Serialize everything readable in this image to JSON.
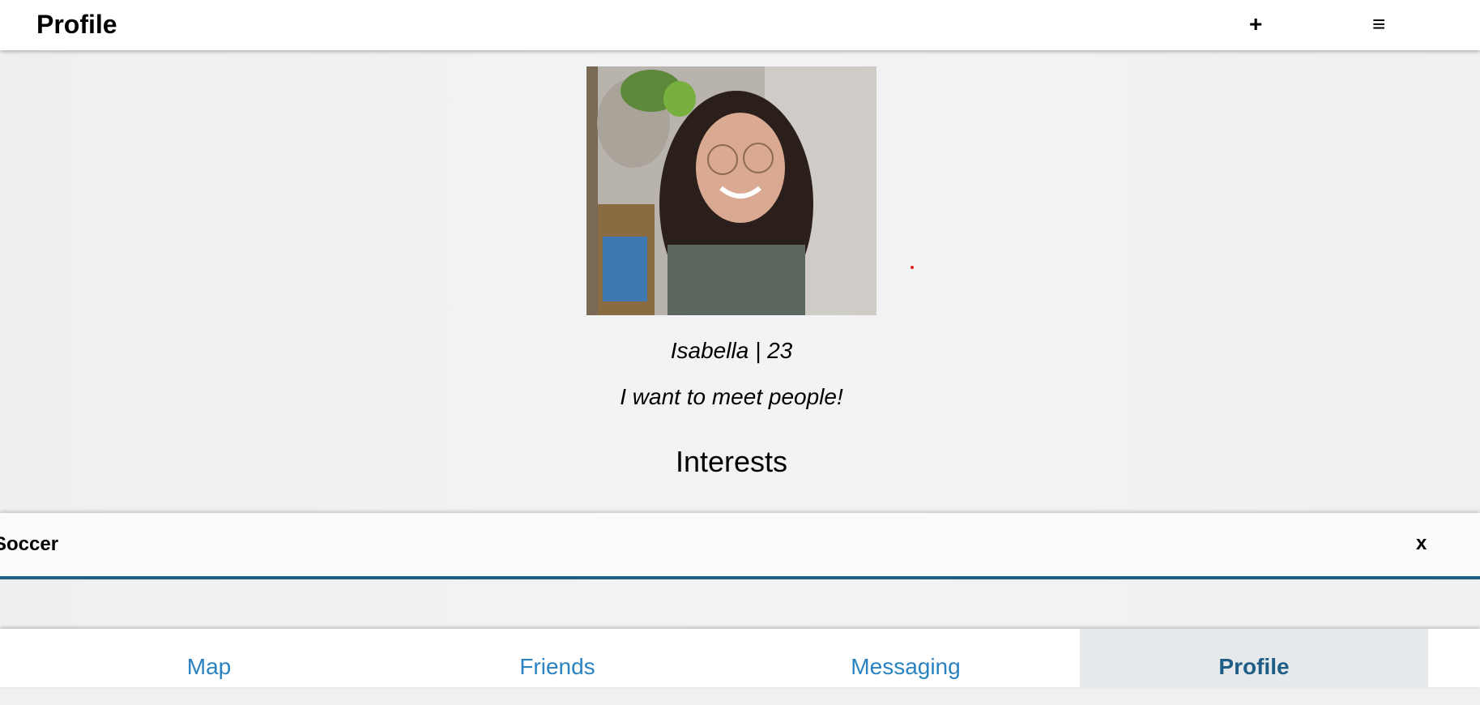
{
  "header": {
    "title": "Profile",
    "add_label": "+",
    "menu_label": "≡"
  },
  "profile": {
    "photo_icon": "profile-photo",
    "name_age": "Isabella | 23",
    "bio": "I want to meet people!"
  },
  "interests": {
    "heading": "Interests",
    "items": [
      {
        "label": "Soccer",
        "remove_label": "x"
      }
    ]
  },
  "nav": {
    "items": [
      {
        "label": "Map"
      },
      {
        "label": "Friends"
      },
      {
        "label": "Messaging"
      },
      {
        "label": "Profile"
      }
    ],
    "active": "Profile"
  },
  "colors": {
    "accent": "#1e5d86",
    "link": "#2a83c0",
    "active_tab_bg": "#e6e9eb"
  }
}
